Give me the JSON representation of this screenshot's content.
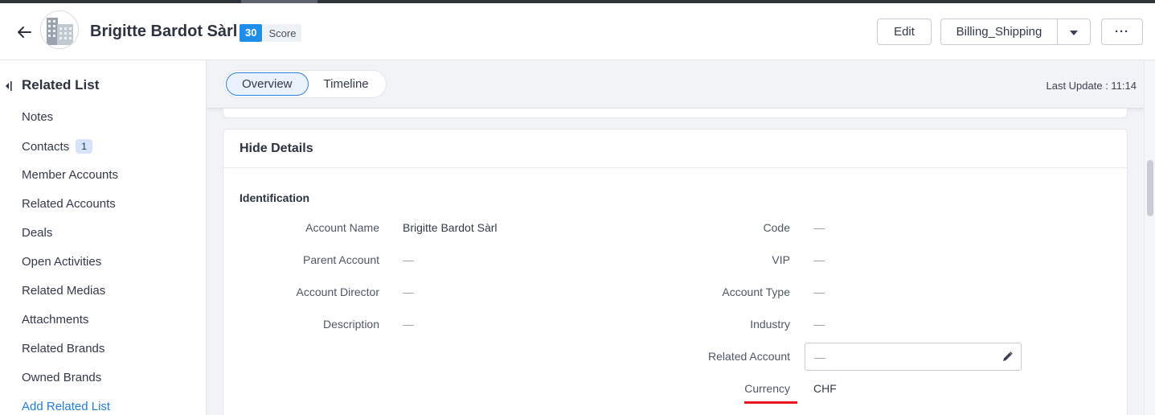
{
  "header": {
    "title": "Brigitte Bardot Sàrl",
    "score_value": "30",
    "score_label": "Score",
    "buttons": {
      "edit": "Edit",
      "billing": "Billing_Shipping",
      "more": "···"
    }
  },
  "sidebar": {
    "title": "Related List",
    "items": [
      {
        "label": "Notes"
      },
      {
        "label": "Contacts",
        "badge": "1"
      },
      {
        "label": "Member Accounts"
      },
      {
        "label": "Related Accounts"
      },
      {
        "label": "Deals"
      },
      {
        "label": "Open Activities"
      },
      {
        "label": "Related Medias"
      },
      {
        "label": "Attachments"
      },
      {
        "label": "Related Brands"
      },
      {
        "label": "Owned Brands"
      }
    ],
    "add_link": "Add Related List"
  },
  "tabs": [
    {
      "label": "Overview",
      "active": true
    },
    {
      "label": "Timeline",
      "active": false
    }
  ],
  "last_update": "Last Update : 11:14",
  "details": {
    "card_title": "Hide Details",
    "section_title": "Identification",
    "left_fields": [
      {
        "label": "Account Name",
        "value": "Brigitte Bardot Sàrl"
      },
      {
        "label": "Parent Account",
        "value": "—"
      },
      {
        "label": "Account Director",
        "value": "—"
      },
      {
        "label": "Description",
        "value": "—"
      }
    ],
    "right_fields": [
      {
        "label": "Code",
        "value": "—"
      },
      {
        "label": "VIP",
        "value": "—"
      },
      {
        "label": "Account Type",
        "value": "—"
      },
      {
        "label": "Industry",
        "value": "—"
      },
      {
        "label": "Related Account",
        "value": "—"
      },
      {
        "label": "Currency",
        "value": "CHF"
      }
    ]
  },
  "colors": {
    "accent": "#1f8ee8",
    "link": "#1f7de0",
    "highlight_underline": "#e8151c"
  },
  "icons": [
    "back-arrow-icon",
    "building-icon",
    "chevron-down-icon",
    "collapse-left-icon",
    "pencil-icon"
  ]
}
